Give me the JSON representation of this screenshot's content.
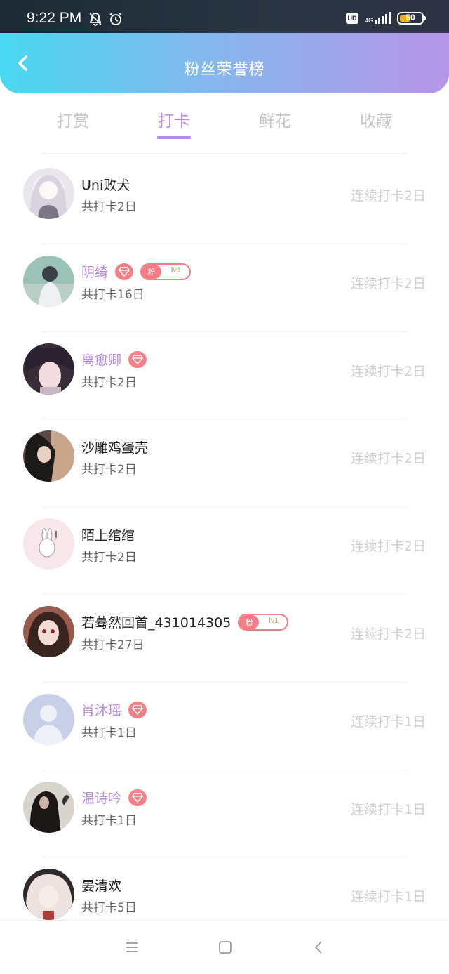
{
  "status_bar": {
    "time": "9:22 PM",
    "icons": [
      "bell-off-icon",
      "alarm-icon"
    ],
    "hd": "HD",
    "network": "4G",
    "battery": "50",
    "battery_level": 0.5
  },
  "header": {
    "title": "粉丝荣誉榜",
    "back_icon": "chevron-left-icon"
  },
  "tabs": [
    {
      "label": "打赏",
      "active": false
    },
    {
      "label": "打卡",
      "active": true
    },
    {
      "label": "鲜花",
      "active": false
    },
    {
      "label": "收藏",
      "active": false
    }
  ],
  "fan_badge": {
    "left": "粉",
    "level": "lv1"
  },
  "colors": {
    "accent_purple": "#b78ae0",
    "badge_red": "#f27d84",
    "header_gradient_start": "#48d8f1",
    "header_gradient_end": "#b796e8"
  },
  "users": [
    {
      "name": "Uni败犬",
      "vip": false,
      "fan_badge": false,
      "total": "共打卡2日",
      "streak": "连续打卡2日"
    },
    {
      "name": "阴绮",
      "vip": true,
      "fan_badge": true,
      "total": "共打卡16日",
      "streak": "连续打卡2日"
    },
    {
      "name": "离愈卿",
      "vip": true,
      "fan_badge": false,
      "total": "共打卡2日",
      "streak": "连续打卡2日"
    },
    {
      "name": "沙雕鸡蛋壳",
      "vip": false,
      "fan_badge": false,
      "total": "共打卡2日",
      "streak": "连续打卡2日"
    },
    {
      "name": "陌上绾绾",
      "vip": false,
      "fan_badge": false,
      "total": "共打卡2日",
      "streak": "连续打卡2日"
    },
    {
      "name": "若蓦然回首_431014305",
      "vip": false,
      "fan_badge": true,
      "total": "共打卡27日",
      "streak": "连续打卡2日"
    },
    {
      "name": "肖沐瑶",
      "vip": true,
      "fan_badge": false,
      "total": "共打卡1日",
      "streak": "连续打卡1日"
    },
    {
      "name": "温诗吟",
      "vip": true,
      "fan_badge": false,
      "total": "共打卡1日",
      "streak": "连续打卡1日"
    },
    {
      "name": "晏清欢",
      "vip": false,
      "fan_badge": false,
      "total": "共打卡5日",
      "streak": "连续打卡1日"
    }
  ],
  "nav_bar": {
    "buttons": [
      "menu-icon",
      "home-square-icon",
      "back-triangle-icon"
    ]
  }
}
